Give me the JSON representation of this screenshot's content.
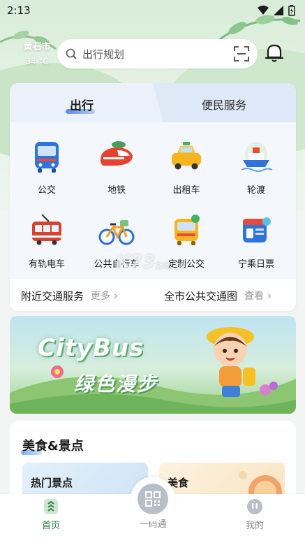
{
  "status_bar": {
    "time": "2:13"
  },
  "weather": {
    "city": "黄石市",
    "temp": "34 °C"
  },
  "search": {
    "placeholder": "出行规划"
  },
  "tabs": {
    "active": "出行",
    "other": "便民服务"
  },
  "transport_grid": [
    {
      "label": "公交",
      "icon": "bus-icon"
    },
    {
      "label": "地铁",
      "icon": "metro-icon"
    },
    {
      "label": "出租车",
      "icon": "taxi-icon"
    },
    {
      "label": "轮渡",
      "icon": "ferry-icon"
    },
    {
      "label": "有轨电车",
      "icon": "tram-icon"
    },
    {
      "label": "公共自行车",
      "icon": "bicycle-icon"
    },
    {
      "label": "定制公交",
      "icon": "custom-bus-icon"
    },
    {
      "label": "宁乘日票",
      "icon": "day-ticket-icon"
    }
  ],
  "quick_links": {
    "nearby": {
      "label": "附近交通服务",
      "action": "更多"
    },
    "citymap": {
      "label": "全市公共交通图",
      "action": "查看"
    }
  },
  "banner": {
    "title": "CityBus",
    "subtitle": "绿色漫步"
  },
  "food_section": {
    "title": "美食&景点",
    "cards": [
      {
        "label": "热门景点"
      },
      {
        "label": "美食"
      }
    ]
  },
  "watermark": {
    "text": "K73",
    "sub": "游戏之家"
  },
  "bottom_nav": {
    "home": "首页",
    "qr": "一码通",
    "mine": "我的"
  },
  "colors": {
    "accent_blue": "#3b7be0",
    "tab_bg": "#dde9f6",
    "nav_active": "#2f7d46"
  }
}
